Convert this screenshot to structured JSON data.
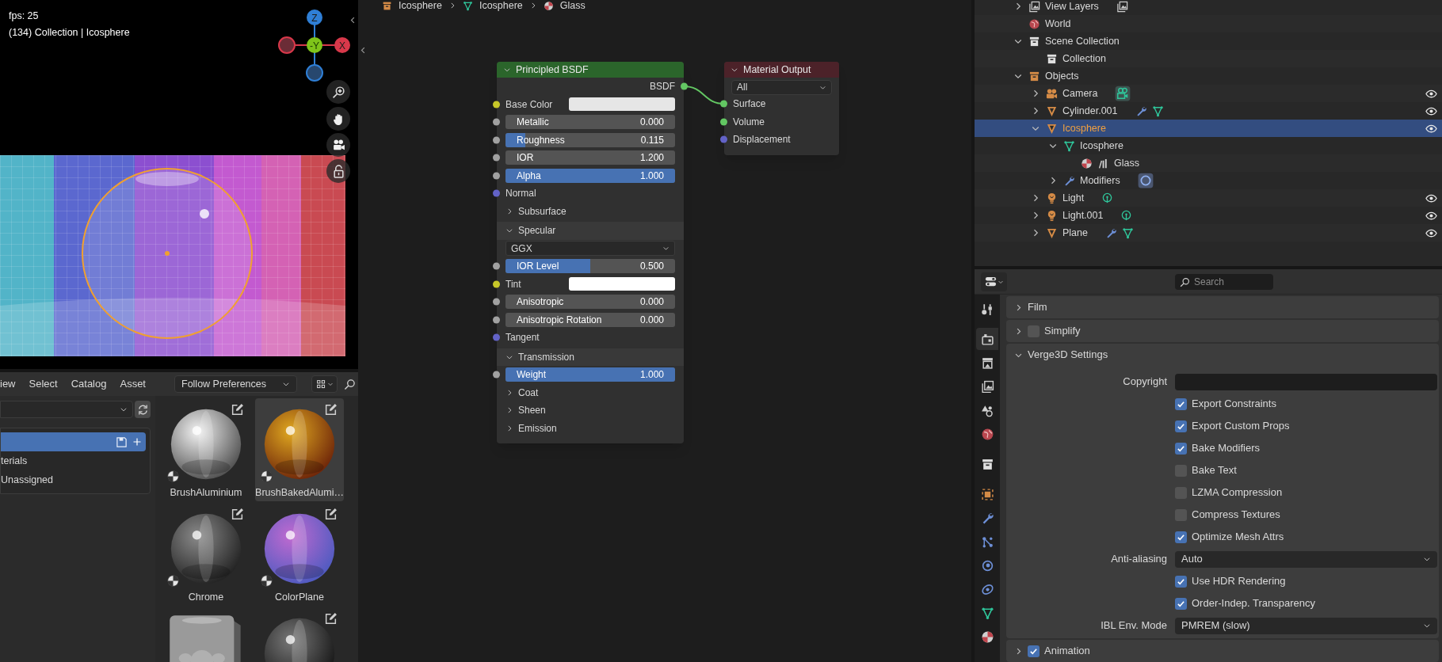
{
  "viewport": {
    "fps": "fps: 25",
    "info": "(134) Collection | Icosphere",
    "gizmo": [
      {
        "kind": "z",
        "label": "Z"
      },
      {
        "kind": "y",
        "label": "-Y"
      },
      {
        "kind": "x",
        "label": "X"
      }
    ]
  },
  "asset_browser": {
    "menu": [
      "iew",
      "Select",
      "Catalog",
      "Asset"
    ],
    "import_method": "Follow Preferences",
    "catalogs": [
      {
        "selected": true
      },
      {
        "label": "terials",
        "selected": false
      },
      {
        "label": "Unassigned",
        "selected": false
      }
    ],
    "assets": [
      {
        "name": "BrushAluminium",
        "kind": "material",
        "selected": false
      },
      {
        "name": "BrushBakedAlumi…",
        "kind": "material",
        "selected": true
      },
      {
        "name": "Chrome",
        "kind": "material",
        "selected": false
      },
      {
        "name": "ColorPlane",
        "kind": "material",
        "selected": false
      },
      {
        "kind": "object",
        "selected": false
      },
      {
        "kind": "material",
        "selected": false
      }
    ]
  },
  "node_editor": {
    "breadcrumbs": [
      "Icosphere",
      "Icosphere",
      "Glass"
    ],
    "nodes": [
      {
        "kind": "principled",
        "title": "Principled BSDF",
        "expanded": true,
        "rows": [
          {
            "kind": "output",
            "label": "BSDF",
            "socket": {
              "color": "#63c763"
            }
          },
          {
            "kind": "color",
            "label": "Base Color",
            "socket": {
              "color": "#c7c729"
            },
            "color": "#e6e6e6"
          },
          {
            "kind": "slider",
            "label": "Metallic",
            "value": "0.000",
            "level": 0,
            "socket": {
              "color": "#a1a1a1"
            }
          },
          {
            "kind": "slider",
            "label": "Roughness",
            "value": "0.115",
            "level": 0.115,
            "socket": {
              "color": "#a1a1a1"
            }
          },
          {
            "kind": "slider",
            "label": "IOR",
            "value": "1.200",
            "level": 0,
            "socket": {
              "color": "#a1a1a1"
            }
          },
          {
            "kind": "slider",
            "label": "Alpha",
            "value": "1.000",
            "level": 1,
            "socket": {
              "color": "#a1a1a1"
            }
          },
          {
            "kind": "input",
            "label": "Normal",
            "socket": {
              "color": "#6363c7"
            }
          },
          {
            "kind": "panel",
            "label": "Subsurface",
            "expanded": false
          },
          {
            "kind": "panel",
            "label": "Specular",
            "expanded": true
          },
          {
            "kind": "dropdown",
            "value": "GGX"
          },
          {
            "kind": "slider",
            "label": "IOR Level",
            "value": "0.500",
            "level": 0.5,
            "socket": {
              "color": "#a1a1a1"
            }
          },
          {
            "kind": "color",
            "label": "Tint",
            "socket": {
              "color": "#c7c729"
            },
            "color": "#ffffff"
          },
          {
            "kind": "slider",
            "label": "Anisotropic",
            "value": "0.000",
            "level": 0,
            "socket": {
              "color": "#a1a1a1"
            }
          },
          {
            "kind": "slider",
            "label": "Anisotropic Rotation",
            "value": "0.000",
            "level": 0,
            "socket": {
              "color": "#a1a1a1"
            }
          },
          {
            "kind": "input",
            "label": "Tangent",
            "socket": {
              "color": "#6363c7"
            }
          },
          {
            "kind": "panel",
            "label": "Transmission",
            "expanded": true
          },
          {
            "kind": "slider",
            "label": "Weight",
            "value": "1.000",
            "level": 1,
            "socket": {
              "color": "#a1a1a1"
            }
          },
          {
            "kind": "panel",
            "label": "Coat",
            "expanded": false
          },
          {
            "kind": "panel",
            "label": "Sheen",
            "expanded": false
          },
          {
            "kind": "panel",
            "label": "Emission",
            "expanded": false
          }
        ]
      },
      {
        "kind": "output",
        "title": "Material Output",
        "expanded": true,
        "target": "All",
        "rows": [
          {
            "kind": "input",
            "label": "Surface",
            "socket": {
              "color": "#63c763"
            }
          },
          {
            "kind": "input",
            "label": "Volume",
            "socket": {
              "color": "#63c763"
            }
          },
          {
            "kind": "input",
            "label": "Displacement",
            "socket": {
              "color": "#6363c7"
            }
          }
        ]
      }
    ]
  },
  "outliner": {
    "items": [
      {
        "label": "View Layers",
        "kind": "view_layers",
        "expanded": false,
        "selected": false,
        "eye": false
      },
      {
        "label": "World",
        "kind": "world",
        "selected": false,
        "eye": false
      },
      {
        "label": "Scene Collection",
        "kind": "collection",
        "expanded": true,
        "selected": false,
        "eye": false,
        "children": [
          {
            "label": "Collection",
            "kind": "collection",
            "selected": false,
            "eye": false
          }
        ]
      },
      {
        "label": "Objects",
        "kind": "objects",
        "expanded": true,
        "selected": false,
        "eye": false,
        "children": [
          {
            "label": "Camera",
            "kind": "camera",
            "expanded": false,
            "selected": false,
            "eye": true
          },
          {
            "label": "Cylinder.001",
            "kind": "mesh_object",
            "expanded": false,
            "selected": false,
            "eye": true
          },
          {
            "label": "Icosphere",
            "kind": "mesh_object",
            "expanded": true,
            "selected": true,
            "eye": true,
            "children": [
              {
                "label": "Icosphere",
                "kind": "mesh_data",
                "expanded": true,
                "selected": false,
                "eye": false,
                "children": [
                  {
                    "label": "Glass",
                    "kind": "material",
                    "selected": false,
                    "eye": false
                  }
                ]
              },
              {
                "label": "Modifiers",
                "kind": "modifiers",
                "expanded": false,
                "selected": false,
                "eye": false
              }
            ]
          },
          {
            "label": "Light",
            "kind": "light",
            "expanded": false,
            "selected": false,
            "eye": true
          },
          {
            "label": "Light.001",
            "kind": "light",
            "expanded": false,
            "selected": false,
            "eye": true
          },
          {
            "label": "Plane",
            "kind": "mesh_object",
            "expanded": false,
            "selected": false,
            "eye": true
          }
        ]
      }
    ]
  },
  "properties": {
    "search": {
      "placeholder": "Search"
    },
    "tabs": [
      {
        "kind": "tool",
        "selected": false
      },
      {
        "kind": "render",
        "selected": true
      },
      {
        "kind": "output",
        "selected": false
      },
      {
        "kind": "view_layer",
        "selected": false
      },
      {
        "kind": "scene",
        "selected": false
      },
      {
        "kind": "world",
        "selected": false
      },
      {
        "kind": "collection",
        "selected": false
      },
      {
        "kind": "object",
        "selected": false
      },
      {
        "kind": "modifiers",
        "selected": false
      },
      {
        "kind": "particles",
        "selected": false
      },
      {
        "kind": "physics",
        "selected": false
      },
      {
        "kind": "constraints",
        "selected": false
      },
      {
        "kind": "data",
        "selected": false
      },
      {
        "kind": "material",
        "selected": false
      }
    ],
    "panels": [
      {
        "label": "Film",
        "expanded": false
      },
      {
        "label": "Simplify",
        "expanded": false,
        "checked": false
      },
      {
        "label": "Verge3D Settings",
        "expanded": true,
        "rows": [
          {
            "kind": "field",
            "label": "Copyright"
          },
          {
            "kind": "checkbox",
            "label": "Export Constraints",
            "checked": true
          },
          {
            "kind": "checkbox",
            "label": "Export Custom Props",
            "checked": true
          },
          {
            "kind": "checkbox",
            "label": "Bake Modifiers",
            "checked": true
          },
          {
            "kind": "checkbox",
            "label": "Bake Text",
            "checked": false
          },
          {
            "kind": "checkbox",
            "label": "LZMA Compression",
            "checked": false
          },
          {
            "kind": "checkbox",
            "label": "Compress Textures",
            "checked": false
          },
          {
            "kind": "checkbox",
            "label": "Optimize Mesh Attrs",
            "checked": true
          },
          {
            "kind": "dropdown",
            "label": "Anti-aliasing",
            "value": "Auto"
          },
          {
            "kind": "checkbox",
            "label": "Use HDR Rendering",
            "checked": true
          },
          {
            "kind": "checkbox",
            "label": "Order-Indep. Transparency",
            "checked": true
          },
          {
            "kind": "dropdown",
            "label": "IBL Env. Mode",
            "value": "PMREM (slow)"
          }
        ]
      },
      {
        "label": "Animation",
        "expanded": false,
        "checked": true
      }
    ]
  }
}
